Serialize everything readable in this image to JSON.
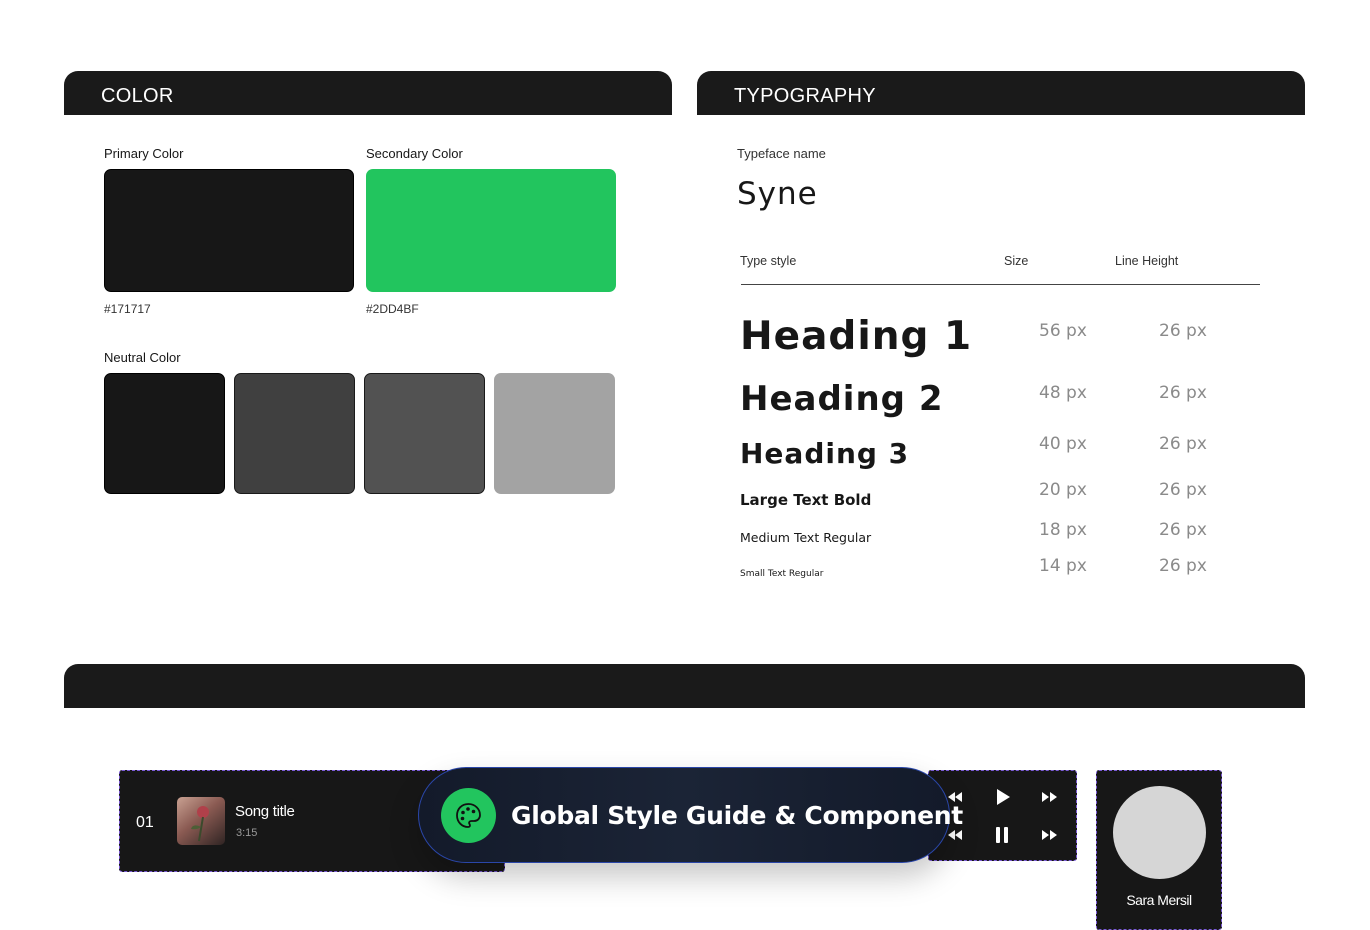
{
  "color_panel": {
    "title": "COLOR",
    "primary_label": "Primary Color",
    "primary_hex": "#171717",
    "secondary_label": "Secondary Color",
    "secondary_hex": "#2DD4BF",
    "neutral_label": "Neutral Color",
    "swatch_colors": {
      "primary": "#171717",
      "secondary": "#22c55e",
      "neutral": [
        "#171717",
        "#404040",
        "#525252",
        "#a3a3a3"
      ]
    }
  },
  "typography_panel": {
    "title": "TYPOGRAPHY",
    "typeface_label": "Typeface name",
    "typeface_name": "Syne",
    "headers": {
      "style": "Type style",
      "size": "Size",
      "line_height": "Line Height"
    },
    "rows": [
      {
        "style": "Heading 1",
        "size": "56 px",
        "line_height": "26 px"
      },
      {
        "style": "Heading 2",
        "size": "48 px",
        "line_height": "26 px"
      },
      {
        "style": "Heading 3",
        "size": "40 px",
        "line_height": "26 px"
      },
      {
        "style": "Large Text Bold",
        "size": "20 px",
        "line_height": "26 px"
      },
      {
        "style": "Medium Text Regular",
        "size": "18 px",
        "line_height": "26 px"
      },
      {
        "style": "Small Text Regular",
        "size": "14 px",
        "line_height": "26 px"
      }
    ]
  },
  "components": {
    "song": {
      "number": "01",
      "title": "Song title",
      "duration": "3:15"
    },
    "badge": {
      "text": "Global Style Guide & Component",
      "icon": "palette-icon",
      "icon_color": "#22c55e"
    },
    "controls": {
      "row1": [
        "rewind-icon",
        "play-icon",
        "fast-forward-icon"
      ],
      "row2": [
        "rewind-icon",
        "pause-icon",
        "fast-forward-icon"
      ]
    },
    "profile": {
      "name": "Sara Mersil"
    }
  }
}
